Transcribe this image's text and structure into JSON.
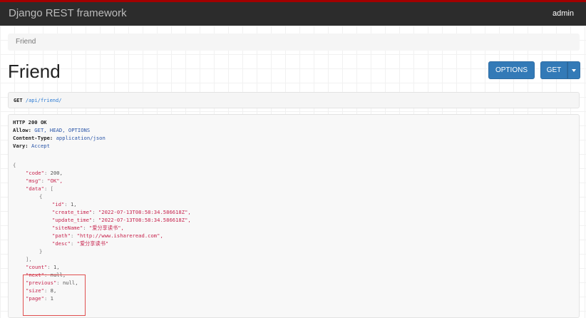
{
  "navbar": {
    "brand": "Django REST framework",
    "user": "admin"
  },
  "breadcrumb": {
    "current": "Friend"
  },
  "page": {
    "title": "Friend"
  },
  "buttons": {
    "options": "OPTIONS",
    "get": "GET"
  },
  "request": {
    "method": "GET",
    "url": "/api/friend/"
  },
  "response": {
    "status": "HTTP 200 OK",
    "headers": [
      {
        "name": "Allow:",
        "value": "GET, HEAD, OPTIONS"
      },
      {
        "name": "Content-Type:",
        "value": "application/json"
      },
      {
        "name": "Vary:",
        "value": "Accept"
      }
    ],
    "body": {
      "open": "{",
      "code_key": "\"code\"",
      "code_val": "200,",
      "msg_key": "\"msg\"",
      "msg_val": "\"OK\",",
      "data_key": "\"data\"",
      "data_open": "[",
      "item_open": "{",
      "id_key": "\"id\"",
      "id_val": "1,",
      "create_key": "\"create_time\"",
      "create_val": "\"2022-07-13T08:58:34.586618Z\",",
      "update_key": "\"update_time\"",
      "update_val": "\"2022-07-13T08:58:34.586618Z\",",
      "site_key": "\"siteName\"",
      "site_val": "\"爱分享读书\",",
      "path_key": "\"path\"",
      "path_val": "\"http://www.ishareread.com\",",
      "desc_key": "\"desc\"",
      "desc_val": "\"爱分享读书\"",
      "item_close": "}",
      "data_close": "],",
      "count_key": "\"count\"",
      "count_val": "1,",
      "next_key": "\"next\"",
      "next_val": "null,",
      "previous_key": "\"previous\"",
      "previous_val": "null,",
      "size_key": "\"size\"",
      "size_val": "8,",
      "page_key": "\"page\"",
      "page_val": "1"
    }
  },
  "colors": {
    "navbar": "#2c2c2c",
    "accent_top": "#a30000",
    "button": "#337ab7",
    "highlight": "#e05050",
    "json_key": "#c7254e"
  }
}
